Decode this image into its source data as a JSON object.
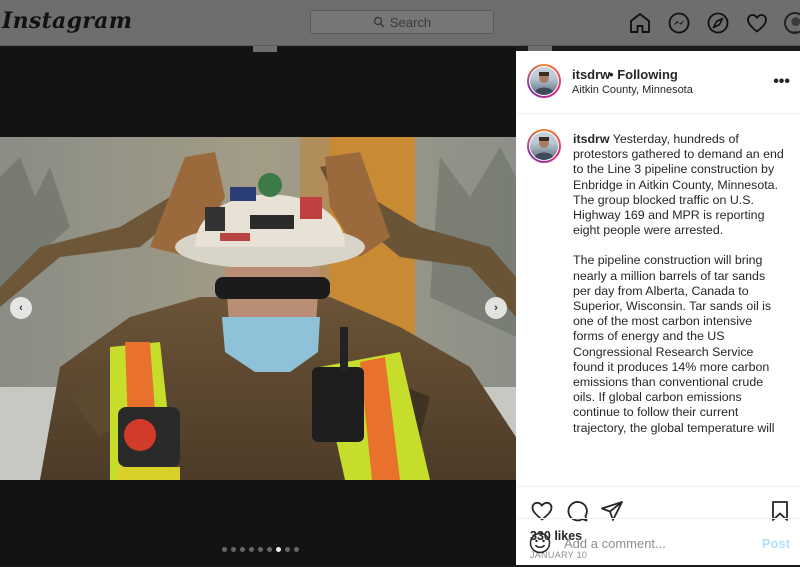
{
  "nav": {
    "logo": "Instagram",
    "search_placeholder": "Search",
    "icons": [
      "home-icon",
      "messenger-icon",
      "explore-icon",
      "heart-icon",
      "profile-avatar"
    ]
  },
  "carousel": {
    "dot_count": 9,
    "active_dot": 7,
    "prev_glyph": "‹",
    "next_glyph": "›"
  },
  "post": {
    "username": "itsdrw",
    "separator": "•",
    "follow_status": "Following",
    "location": "Aitkin County, Minnesota",
    "more_glyph": "•••",
    "caption_user": "itsdrw",
    "caption_p1": "Yesterday, hundreds of protestors gathered to demand an end to the Line 3 pipeline construction by Enbridge in Aitkin County, Minnesota. The group blocked traffic on U.S. Highway 169 and MPR is reporting eight people were arrested.",
    "caption_p2": "The pipeline construction will bring nearly a million barrels of tar sands per day from Alberta, Canada to Superior, Wisconsin. Tar sands oil is one of the most carbon intensive forms of energy and the US Congressional Research Service found it produces 14% more carbon emissions than conventional crude oils. If global carbon emissions continue to follow their current trajectory, the global temperature will",
    "likes": "330 likes",
    "date": "JANUARY 10",
    "comment_placeholder": "Add a comment...",
    "post_button": "Post"
  },
  "colors": {
    "dim_overlay": "#6e6e6e",
    "backdrop": "#131313",
    "post_link": "#b2dffc",
    "text": "#262626",
    "muted": "#8e8e8e"
  }
}
